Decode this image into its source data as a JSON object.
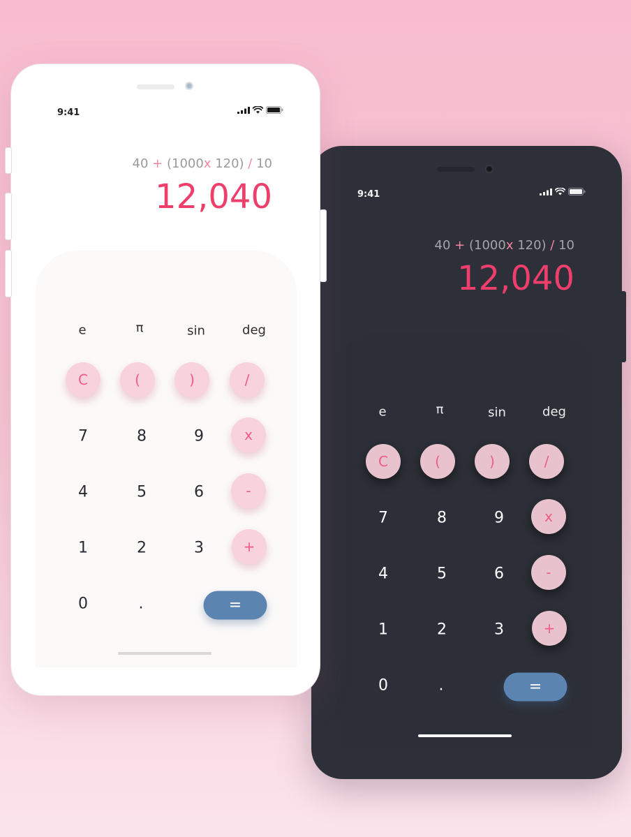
{
  "colors": {
    "accent_pink": "#ee3f6c",
    "operator_pink": "#f2879f",
    "key_pink_light": "#f8d2dc",
    "key_pink_dark": "#e8c3cd",
    "equals_blue": "#5c84b1",
    "dark_body": "#2d3039",
    "light_body": "#ffffff"
  },
  "status": {
    "time": "9:41",
    "icons": [
      "cellular-signal-icon",
      "wifi-icon",
      "battery-icon"
    ]
  },
  "display": {
    "expr": {
      "a": "40",
      "op1": " + ",
      "b": "(1000",
      "op2": "x",
      "c": " 120)",
      "op3": " / ",
      "d": "10"
    },
    "result": "12,040"
  },
  "keys": {
    "e": "e",
    "pi": "π",
    "sin": "sin",
    "deg": "deg",
    "clear": "C",
    "lparen": "(",
    "rparen": ")",
    "divide": "/",
    "n7": "7",
    "n8": "8",
    "n9": "9",
    "multiply": "x",
    "n4": "4",
    "n5": "5",
    "n6": "6",
    "minus": "-",
    "n1": "1",
    "n2": "2",
    "n3": "3",
    "plus": "+",
    "n0": "0",
    "dot": ".",
    "equals": "="
  }
}
